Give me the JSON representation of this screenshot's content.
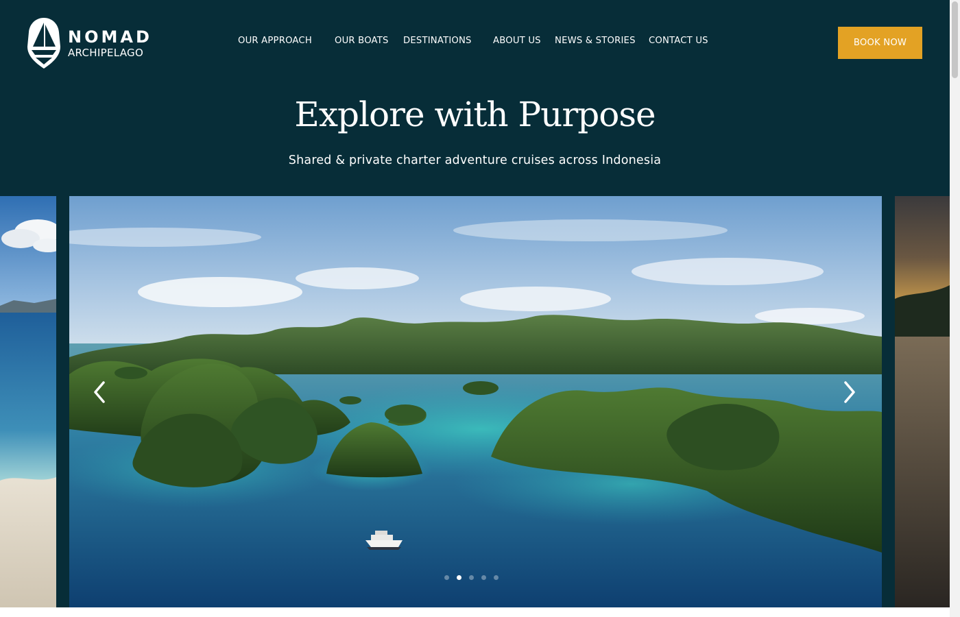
{
  "brand": {
    "name_line1": "NOMAD",
    "name_line2": "ARCHIPELAGO"
  },
  "nav": {
    "items": [
      {
        "label": "OUR APPROACH"
      },
      {
        "label": "OUR BOATS"
      },
      {
        "label": "DESTINATIONS"
      },
      {
        "label": "ABOUT US"
      },
      {
        "label": "NEWS & STORIES"
      },
      {
        "label": "CONTACT US"
      }
    ],
    "cta_label": "BOOK NOW"
  },
  "hero": {
    "title": "Explore with Purpose",
    "subtitle": "Shared & private charter adventure cruises across Indonesia"
  },
  "carousel": {
    "slide_count": 5,
    "active_index": 1,
    "prev_icon": "chevron-left-icon",
    "next_icon": "chevron-right-icon"
  },
  "colors": {
    "brand_dark": "#072d38",
    "accent": "#e3a224",
    "text_light": "#ffffff"
  }
}
